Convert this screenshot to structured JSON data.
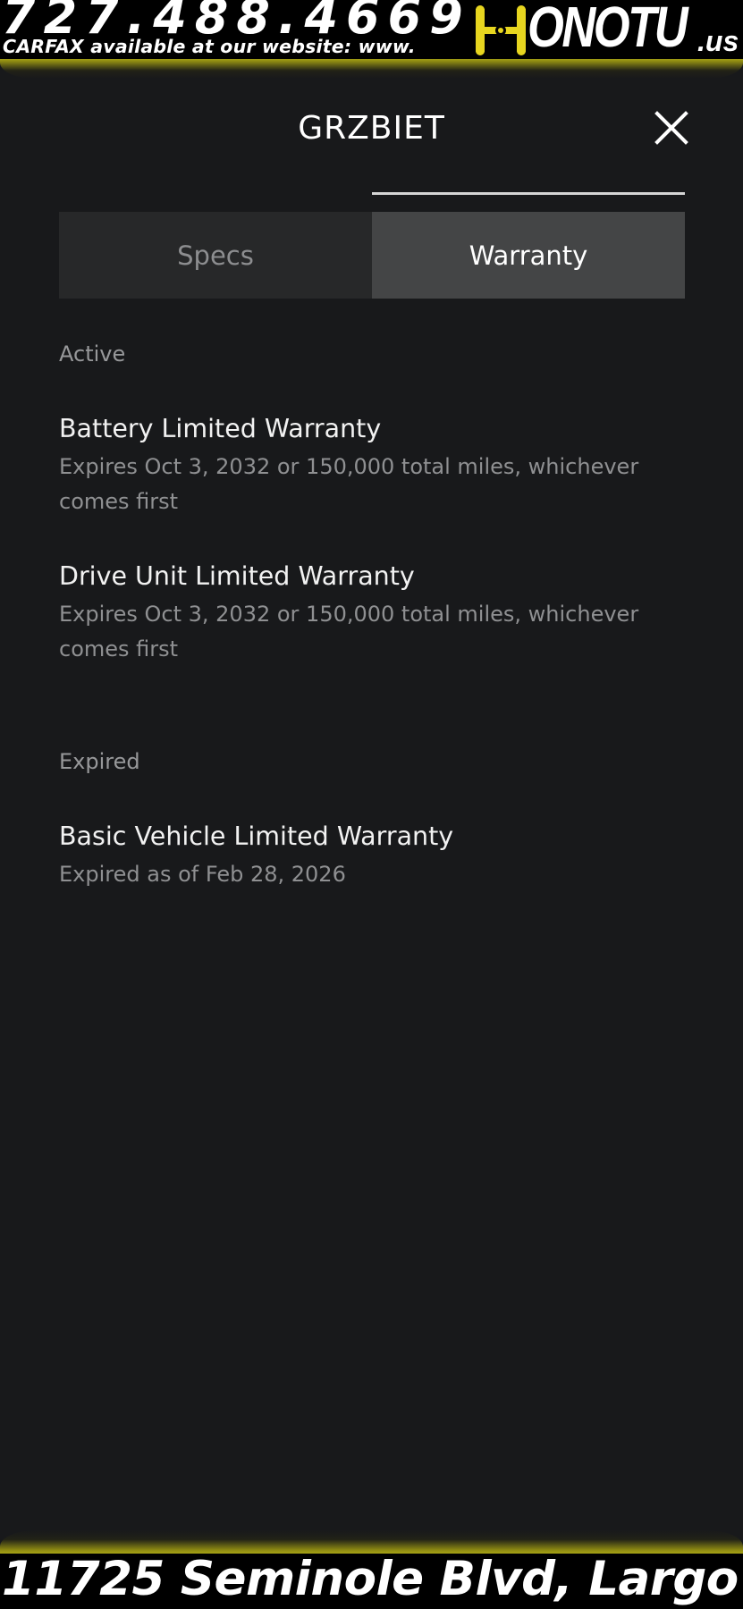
{
  "banner": {
    "phone": "727.488.4669",
    "carfax_text": "CARFAX available at our website: www.",
    "logo_text": "ONOTU",
    "logo_suffix": ".us",
    "logo_full": "HONOTU.us",
    "address": "11725 Seminole Blvd, Largo",
    "accent_color": "#d6d21a"
  },
  "modal": {
    "title": "GRZBIET",
    "close_icon": "close-icon",
    "tabs": [
      {
        "label": "Specs",
        "selected": false
      },
      {
        "label": "Warranty",
        "selected": true
      }
    ]
  },
  "warranty": {
    "active_label": "Active",
    "active_items": [
      {
        "title": "Battery Limited Warranty",
        "description": "Expires Oct 3, 2032 or 150,000 total miles, whichever comes first"
      },
      {
        "title": "Drive Unit Limited Warranty",
        "description": "Expires Oct 3, 2032 or 150,000 total miles, whichever comes first"
      }
    ],
    "expired_label": "Expired",
    "expired_items": [
      {
        "title": "Basic Vehicle Limited Warranty",
        "description": "Expired as of Feb 28, 2026"
      }
    ]
  }
}
